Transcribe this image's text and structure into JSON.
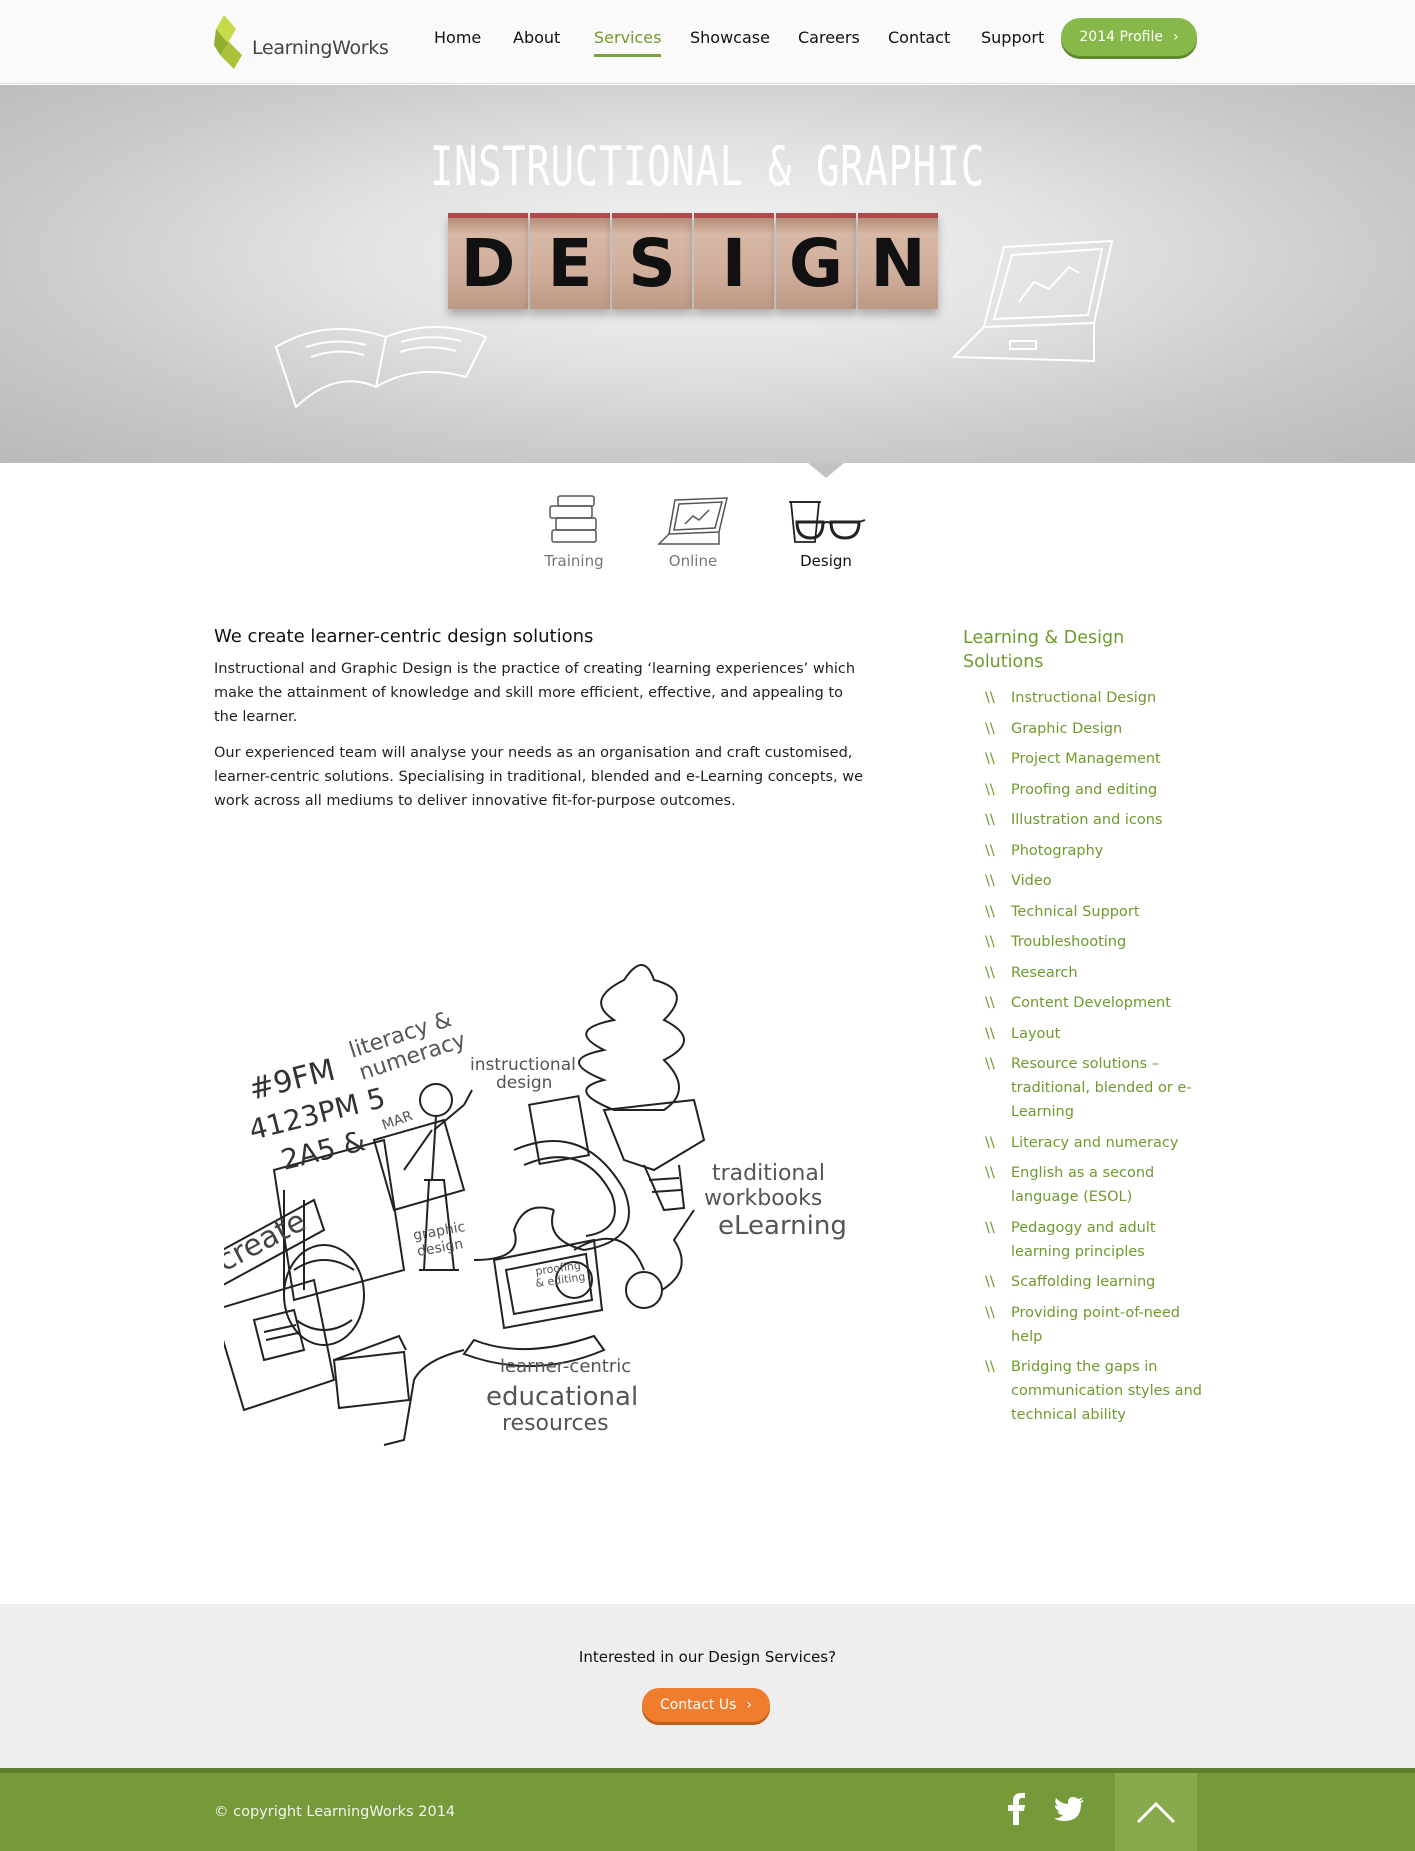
{
  "brand": {
    "name": "LearningWorks",
    "accent": "#7aa33a",
    "cta_color": "#ef7d2d"
  },
  "nav": {
    "items": [
      "Home",
      "About",
      "Services",
      "Showcase",
      "Careers",
      "Contact",
      "Support"
    ],
    "active": "Services",
    "profile_button": "2014 Profile"
  },
  "hero": {
    "title": "INSTRUCTIONAL & GRAPHIC",
    "blocks": [
      "D",
      "E",
      "S",
      "I",
      "G",
      "N"
    ]
  },
  "subtabs": [
    {
      "label": "Training",
      "icon": "books-icon"
    },
    {
      "label": "Online",
      "icon": "laptop-icon"
    },
    {
      "label": "Design",
      "icon": "glasses-icon"
    }
  ],
  "main": {
    "heading": "We create learner-centric design solutions",
    "paragraphs": [
      "Instructional and Graphic Design is the practice of creating ‘learning experiences’ which make the attainment of knowledge and skill more efficient, effective, and appealing to the learner.",
      "Our experienced team will analyse your needs as an organisation and craft customised, learner-centric solutions. Specialising in traditional, blended and e-Learning concepts, we work across all mediums to deliver innovative fit-for-purpose outcomes."
    ],
    "illustration_words": {
      "literacy": "literacy &",
      "numeracy": "numeracy",
      "instructional1": "instructional",
      "instructional2": "design",
      "mar": "MAR",
      "numbers1": "#9FM",
      "numbers2": "4123PM 5",
      "numbers3": "2A5 &",
      "traditional": "traditional",
      "workbooks": "workbooks",
      "elearning": "eLearning",
      "create": "create",
      "graphic1": "graphic",
      "graphic2": "design",
      "proofing1": "proofing",
      "proofing2": "& editing",
      "learner": "learner-centric",
      "educational": "educational",
      "resources": "resources"
    }
  },
  "sidebar": {
    "title": "Learning & Design Solutions",
    "bullet": "\\\\",
    "items": [
      "Instructional Design",
      "Graphic Design",
      "Project Management",
      "Proofing and editing",
      "Illustration and icons",
      "Photography",
      "Video",
      "Technical Support",
      "Troubleshooting",
      "Research",
      "Content Development",
      "Layout",
      "Resource solutions – traditional, blended or e-Learning",
      "Literacy and numeracy",
      "English as a second language (ESOL)",
      "Pedagogy and adult learning principles",
      "Scaffolding learning",
      "Providing point-of-need help",
      "Bridging the gaps in communication styles and technical ability"
    ]
  },
  "cta": {
    "text": "Interested in our Design Services?",
    "button": "Contact Us"
  },
  "footer": {
    "copyright": "© copyright LearningWorks 2014",
    "social": [
      "facebook-icon",
      "twitter-icon"
    ],
    "to_top_icon": "chevron-up-icon"
  }
}
